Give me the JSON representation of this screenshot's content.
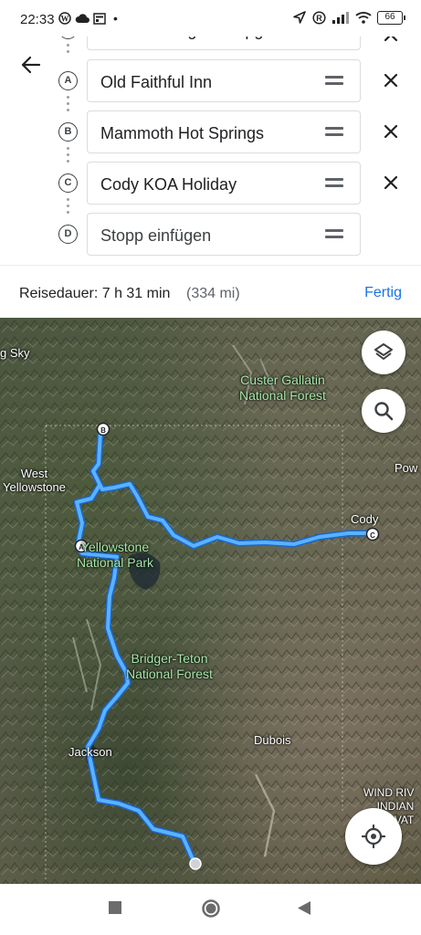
{
  "status_bar": {
    "time": "22:33",
    "battery": "66"
  },
  "route": {
    "stops": [
      {
        "marker": "",
        "value": "Warren Bridge Campgrou..."
      },
      {
        "marker": "A",
        "value": "Old Faithful Inn"
      },
      {
        "marker": "B",
        "value": "Mammoth Hot Springs"
      },
      {
        "marker": "C",
        "value": "Cody KOA Holiday"
      },
      {
        "marker": "D",
        "placeholder": "Stopp einfügen"
      }
    ]
  },
  "summary": {
    "duration": "Reisedauer: 7 h 31 min",
    "distance": "(334 mi)",
    "done_label": "Fertig"
  },
  "map": {
    "labels": {
      "big_sky": "g Sky",
      "west_yellowstone": "West\nYellowstone",
      "cody": "Cody",
      "powell": "Pow",
      "jackson": "Jackson",
      "dubois": "Dubois",
      "wind_river": "WIND RIV\nINDIAN\nVAT"
    },
    "parks": {
      "custer_gallatin": "Custer Gallatin\nNational Forest",
      "yellowstone": "Yellowstone\nNational Park",
      "bridger_teton": "Bridger-Teton\nNational Forest"
    },
    "pins": {
      "a": "A",
      "b": "B",
      "c": "C"
    },
    "route_color": "#4fa8ff",
    "route_outline": "#1a66cc"
  },
  "icons": {
    "back": "arrow-back-icon",
    "layers": "layers-icon",
    "search": "search-icon",
    "locate": "my-location-icon",
    "remove": "close-icon",
    "drag": "drag-handle-icon"
  }
}
